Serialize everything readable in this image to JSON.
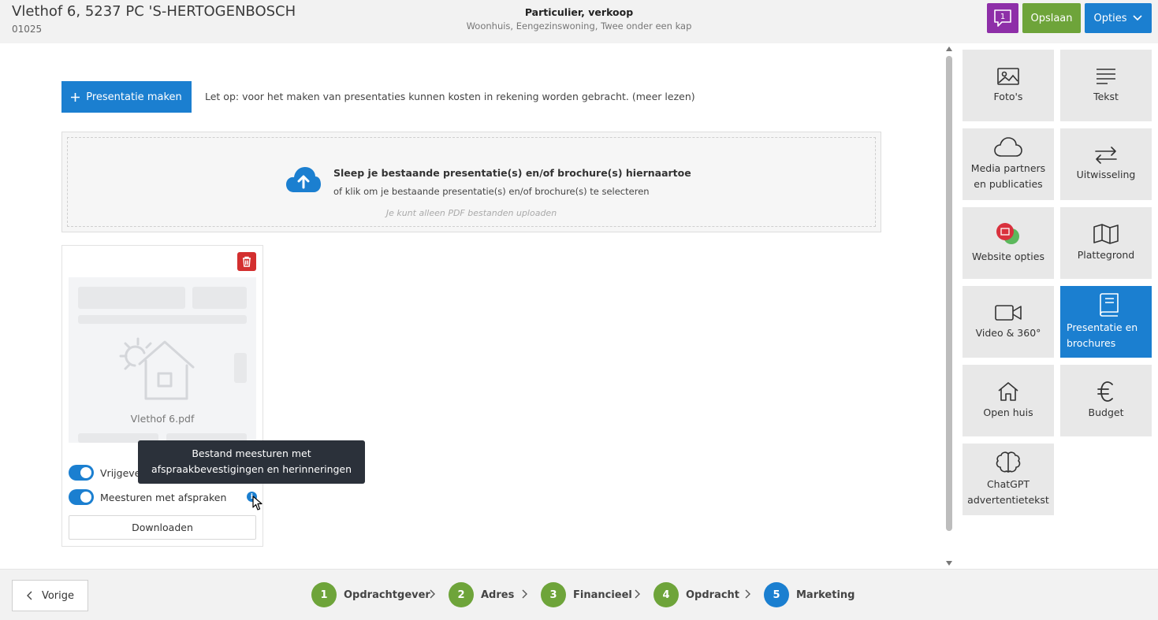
{
  "header": {
    "address": "Vlethof 6, 5237 PC 'S-HERTOGENBOSCH",
    "code": "01025",
    "type_title": "Particulier, verkoop",
    "type_sub": "Woonhuis, Eengezinswoning, Twee onder een kap",
    "chat_count": "1",
    "save_label": "Opslaan",
    "options_label": "Opties"
  },
  "main": {
    "create_label": "Presentatie maken",
    "note": "Let op: voor het maken van presentaties kunnen kosten in rekening worden gebracht. (meer lezen)",
    "dropzone": {
      "title": "Sleep je bestaande presentatie(s) en/of brochure(s) hiernaartoe",
      "subtitle": "of klik om je bestaande presentatie(s) en/of brochure(s) te selecteren",
      "hint": "Je kunt alleen PDF bestanden uploaden"
    },
    "card": {
      "file_name": "Vlethof 6.pdf",
      "toggle_release": "Vrijgeven",
      "toggle_send": "Meesturen met afspraken",
      "download_label": "Downloaden",
      "tooltip_line1": "Bestand meesturen met",
      "tooltip_line2": "afspraakbevestigingen en herinneringen"
    }
  },
  "side_tiles": [
    {
      "label": "Foto's",
      "icon": "image-icon"
    },
    {
      "label": "Tekst",
      "icon": "text-lines-icon"
    },
    {
      "label": "Media partners\nen publicaties",
      "icon": "cloud-icon"
    },
    {
      "label": "Uitwisseling",
      "icon": "exchange-arrows-icon"
    },
    {
      "label": "Website opties",
      "icon": "website-badge-icon"
    },
    {
      "label": "Plattegrond",
      "icon": "map-icon"
    },
    {
      "label": "Video & 360°",
      "icon": "video-camera-icon"
    },
    {
      "label": "Presentatie en\nbrochures",
      "icon": "book-icon",
      "active": true
    },
    {
      "label": "Open huis",
      "icon": "house-icon"
    },
    {
      "label": "Budget",
      "icon": "euro-icon"
    },
    {
      "label": "ChatGPT\nadvertentietekst",
      "icon": "brain-icon"
    }
  ],
  "footer": {
    "prev_label": "Vorige",
    "steps": [
      {
        "num": "1",
        "label": "Opdrachtgever"
      },
      {
        "num": "2",
        "label": "Adres"
      },
      {
        "num": "3",
        "label": "Financieel"
      },
      {
        "num": "4",
        "label": "Opdracht"
      },
      {
        "num": "5",
        "label": "Marketing",
        "current": true
      }
    ]
  },
  "colors": {
    "primary": "#1b7fd0",
    "success": "#6ea43a",
    "chat": "#8e2fa8",
    "danger": "#d32f2f",
    "tooltip_bg": "#2b313a"
  }
}
